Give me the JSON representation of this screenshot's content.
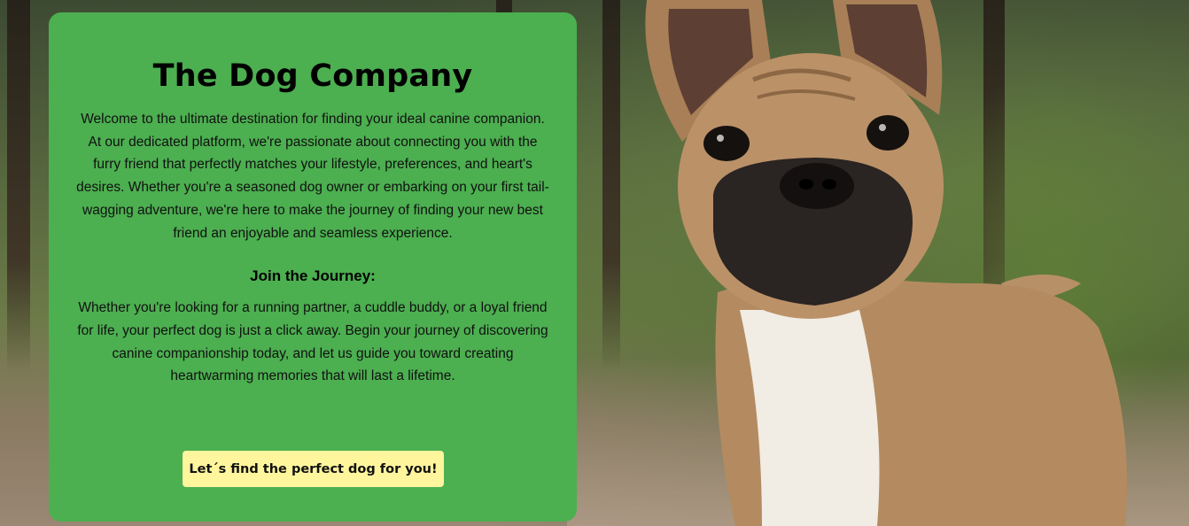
{
  "hero": {
    "title": "The Dog Company",
    "intro": "Welcome to the ultimate destination for finding your ideal canine companion. At our dedicated platform, we're passionate about connecting you with the furry friend that perfectly matches your lifestyle, preferences, and heart's desires. Whether you're a seasoned dog owner or embarking on your first tail-wagging adventure, we're here to make the journey of finding your new best friend an enjoyable and seamless experience.",
    "subheading": "Join the Journey:",
    "journey_text": "Whether you're looking for a running partner, a cuddle buddy, or a loyal friend for life, your perfect dog is just a click away. Begin your journey of discovering canine companionship today, and let us guide you toward creating heartwarming memories that will last a lifetime.",
    "cta_label": "Let´s find the perfect dog for you!"
  },
  "colors": {
    "card_background": "#4caf50",
    "button_background": "#fff59d"
  },
  "background_image": "french-bulldog-photo"
}
